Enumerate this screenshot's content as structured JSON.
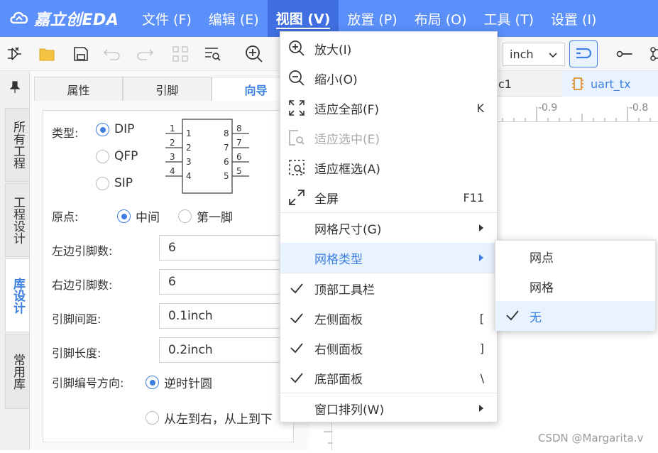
{
  "app": {
    "logo_text": "嘉立创EDA",
    "logo_icon": "cloud-icon",
    "brand_color": "#5b8ff9",
    "accent_color": "#3d7fe0"
  },
  "menubar": [
    {
      "label": "文件 (F)"
    },
    {
      "label": "编辑 (E)"
    },
    {
      "label": "视图 (V)",
      "active": true
    },
    {
      "label": "放置 (P)"
    },
    {
      "label": "布局 (O)"
    },
    {
      "label": "工具 (T)"
    },
    {
      "label": "设置 (I)"
    }
  ],
  "toolbar": {
    "icons": [
      "wizard-icon",
      "open-folder-icon",
      "save-icon",
      "undo-icon",
      "redo-icon",
      "grid-icon",
      "find-icon",
      "zoom-in-icon",
      "wire-icon",
      "netflag-icon"
    ],
    "unit_value": "inch"
  },
  "left_strip": {
    "pin_icon": "pin-icon",
    "tabs": [
      {
        "label": "所有工程"
      },
      {
        "label": "工程设计"
      },
      {
        "label": "库设计",
        "active": true
      },
      {
        "label": "常用库"
      }
    ]
  },
  "panel": {
    "tabs": [
      {
        "label": "属性"
      },
      {
        "label": "引脚"
      },
      {
        "label": "向导",
        "active": true
      }
    ],
    "type_label": "类型:",
    "type_options": [
      {
        "label": "DIP",
        "selected": true
      },
      {
        "label": "QFP",
        "selected": false
      },
      {
        "label": "SIP",
        "selected": false
      }
    ],
    "preview_pins_left": [
      "1",
      "2",
      "3",
      "4"
    ],
    "preview_pins_right": [
      "8",
      "7",
      "6",
      "5"
    ],
    "origin_label": "原点:",
    "origin_options": [
      {
        "label": "中间",
        "selected": true
      },
      {
        "label": "第一脚",
        "selected": false
      }
    ],
    "fields": [
      {
        "label": "左边引脚数:",
        "value": "6"
      },
      {
        "label": "右边引脚数:",
        "value": "6"
      },
      {
        "label": "引脚间距:",
        "value": "0.1inch"
      },
      {
        "label": "引脚长度:",
        "value": "0.2inch"
      }
    ],
    "numbering_label": "引脚编号方向:",
    "numbering_options": [
      {
        "label": "逆时针圆",
        "selected": true
      },
      {
        "label": "从左到右，从上到下",
        "selected": false
      }
    ]
  },
  "doc_tabs": [
    {
      "label": "c1"
    },
    {
      "label": "uart_tx",
      "active": true,
      "icon": "chip-icon"
    }
  ],
  "ruler": {
    "labels": [
      "-0.9",
      "-0.8"
    ]
  },
  "view_menu": [
    {
      "icon": "zoom-in-icon",
      "label": "放大(I)",
      "shortcut": ""
    },
    {
      "icon": "zoom-out-icon",
      "label": "缩小(O)",
      "shortcut": ""
    },
    {
      "icon": "fit-all-icon",
      "label": "适应全部(F)",
      "shortcut": "K"
    },
    {
      "icon": "fit-selection-icon",
      "label": "适应选中(E)",
      "shortcut": "",
      "disabled": true
    },
    {
      "icon": "fit-box-icon",
      "label": "适应框选(A)",
      "shortcut": ""
    },
    {
      "icon": "fullscreen-icon",
      "label": "全屏",
      "shortcut": "F11"
    },
    {
      "label": "网格尺寸(G)",
      "submenu": true
    },
    {
      "label": "网格类型",
      "submenu": true,
      "highlighted": true
    },
    {
      "label": "顶部工具栏",
      "checked": true,
      "shortcut": ""
    },
    {
      "label": "左侧面板",
      "checked": true,
      "shortcut": "["
    },
    {
      "label": "右侧面板",
      "checked": true,
      "shortcut": "]"
    },
    {
      "label": "底部面板",
      "checked": true,
      "shortcut": "\\"
    },
    {
      "label": "窗口排列(W)",
      "submenu": true
    }
  ],
  "grid_type_submenu": [
    {
      "label": "网点",
      "checked": false
    },
    {
      "label": "网格",
      "checked": false
    },
    {
      "label": "无",
      "checked": true
    }
  ],
  "watermark": "CSDN @Margarita.v"
}
